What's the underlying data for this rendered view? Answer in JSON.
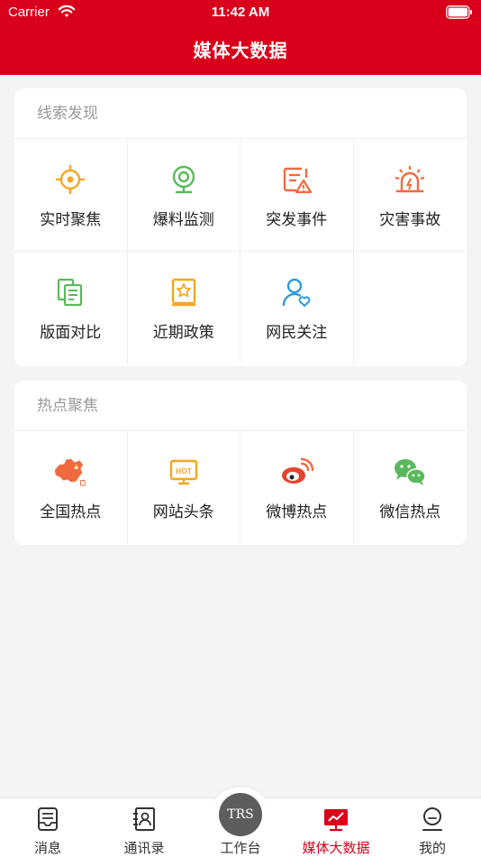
{
  "status_bar": {
    "carrier": "Carrier",
    "time": "11:42 AM"
  },
  "nav": {
    "title": "媒体大数据"
  },
  "colors": {
    "brand_red": "#d9001b",
    "orange": "#f5a623",
    "green": "#5cb85c",
    "coral": "#f06a3f",
    "blue": "#2e9bd8"
  },
  "sections": [
    {
      "title": "线索发现",
      "items": [
        {
          "label": "实时聚焦",
          "icon": "crosshair-icon"
        },
        {
          "label": "爆料监测",
          "icon": "webcam-icon"
        },
        {
          "label": "突发事件",
          "icon": "alert-document-icon"
        },
        {
          "label": "灾害事故",
          "icon": "alarm-siren-icon"
        },
        {
          "label": "版面对比",
          "icon": "pages-compare-icon"
        },
        {
          "label": "近期政策",
          "icon": "policy-book-icon"
        },
        {
          "label": "网民关注",
          "icon": "user-heart-icon"
        }
      ]
    },
    {
      "title": "热点聚焦",
      "items": [
        {
          "label": "全国热点",
          "icon": "china-map-icon"
        },
        {
          "label": "网站头条",
          "icon": "hot-monitor-icon",
          "icon_text": "HOT"
        },
        {
          "label": "微博热点",
          "icon": "weibo-icon"
        },
        {
          "label": "微信热点",
          "icon": "wechat-icon"
        }
      ]
    }
  ],
  "tabbar": {
    "tabs": [
      {
        "label": "消息",
        "icon": "inbox-icon"
      },
      {
        "label": "通讯录",
        "icon": "contacts-book-icon"
      },
      {
        "label": "工作台",
        "icon": "trs-logo",
        "logo_text": "TRS"
      },
      {
        "label": "媒体大数据",
        "icon": "monitor-chart-icon",
        "active": true
      },
      {
        "label": "我的",
        "icon": "user-profile-icon"
      }
    ]
  }
}
